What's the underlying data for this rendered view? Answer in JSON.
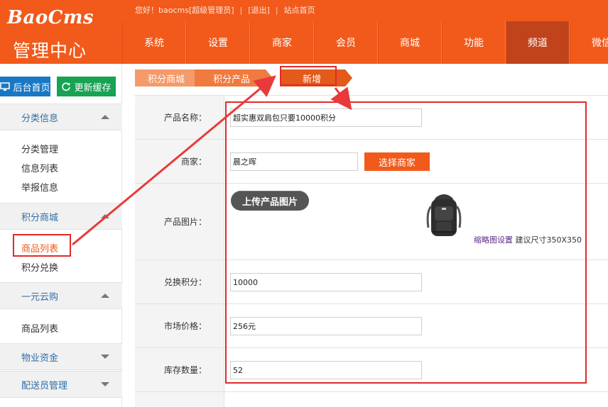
{
  "header": {
    "logo": "BaoCms",
    "logo_sub": "管理中心",
    "greeting": "您好！baocms[超级管理员]",
    "logout": "[退出]",
    "site_home": "站点首页",
    "nav": [
      "系统",
      "设置",
      "商家",
      "会员",
      "商城",
      "功能",
      "频道",
      "微信"
    ],
    "active_nav": "频道"
  },
  "sidebar": {
    "home_button": "后台首页",
    "cache_button": "更新缓存",
    "sections": [
      {
        "title": "分类信息",
        "expanded": true,
        "items": [
          "分类管理",
          "信息列表",
          "举报信息"
        ]
      },
      {
        "title": "积分商城",
        "expanded": true,
        "items": [
          "商品列表",
          "积分兑换"
        ],
        "active_item": "商品列表"
      },
      {
        "title": "一元云购",
        "expanded": true,
        "items": [
          "商品列表"
        ]
      },
      {
        "title": "物业资金",
        "expanded": false,
        "items": []
      },
      {
        "title": "配送员管理",
        "expanded": false,
        "items": []
      }
    ]
  },
  "breadcrumb": [
    "积分商城",
    "积分产品",
    "新增"
  ],
  "form": {
    "product_name_label": "产品名称：",
    "product_name_value": "超实惠双肩包只要10000积分",
    "merchant_label": "商家：",
    "merchant_value": "晨之晖",
    "select_merchant_button": "选择商家",
    "image_label": "产品图片：",
    "upload_button": "上传产品图片",
    "thumb_settings_link": "缩略图设置",
    "thumb_size_note": "建议尺寸350X350",
    "points_label": "兑换积分：",
    "points_value": "10000",
    "market_price_label": "市场价格：",
    "market_price_value": "256元",
    "stock_label": "库存数量：",
    "stock_value": "52"
  },
  "colors": {
    "brand_orange": "#f15a1b",
    "active_nav": "#c0431b",
    "annotation_red": "#e02b2b",
    "home_button": "#1a78c3",
    "cache_button": "#17a254"
  }
}
